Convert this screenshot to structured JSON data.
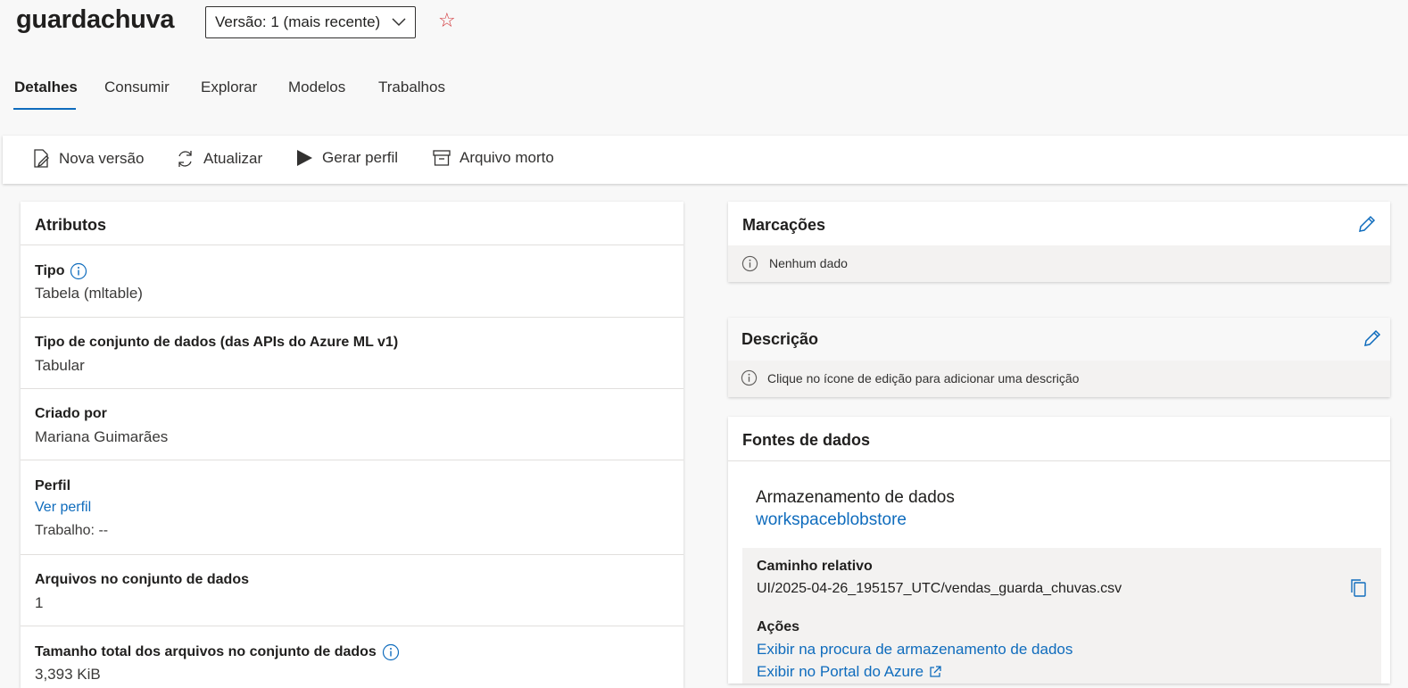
{
  "header": {
    "title": "guardachuva",
    "version_select": "Versão: 1 (mais recente)"
  },
  "tabs": [
    {
      "label": "Detalhes",
      "active": true
    },
    {
      "label": "Consumir"
    },
    {
      "label": "Explorar"
    },
    {
      "label": "Modelos"
    },
    {
      "label": "Trabalhos"
    }
  ],
  "toolbar": {
    "new_version": "Nova versão",
    "refresh": "Atualizar",
    "generate_profile": "Gerar perfil",
    "archive": "Arquivo morto"
  },
  "attributes": {
    "title": "Atributos",
    "type_label": "Tipo",
    "type_value": "Tabela (mltable)",
    "dataset_type_label": "Tipo de conjunto de dados (das APIs do Azure ML v1)",
    "dataset_type_value": "Tabular",
    "created_by_label": "Criado por",
    "created_by_value": "Mariana Guimarães",
    "profile_label": "Perfil",
    "profile_link": "Ver perfil",
    "profile_job": "Trabalho: --",
    "files_label": "Arquivos no conjunto de dados",
    "files_value": "1",
    "size_label": "Tamanho total dos arquivos no conjunto de dados",
    "size_value": "3,393 KiB"
  },
  "tags": {
    "title": "Marcações",
    "empty": "Nenhum dado"
  },
  "description": {
    "title": "Descrição",
    "hint": "Clique no ícone de edição para adicionar uma descrição"
  },
  "datasources": {
    "title": "Fontes de dados",
    "storage_label": "Armazenamento de dados",
    "storage_link": "workspaceblobstore",
    "relative_path_label": "Caminho relativo",
    "relative_path_value": "UI/2025-04-26_195157_UTC/vendas_guarda_chuvas.csv",
    "actions_label": "Ações",
    "action_browse": "Exibir na procura de armazenamento de dados",
    "action_portal": "Exibir no Portal do Azure"
  },
  "colors": {
    "accent": "#0f6cbd",
    "star": "#d13438"
  }
}
